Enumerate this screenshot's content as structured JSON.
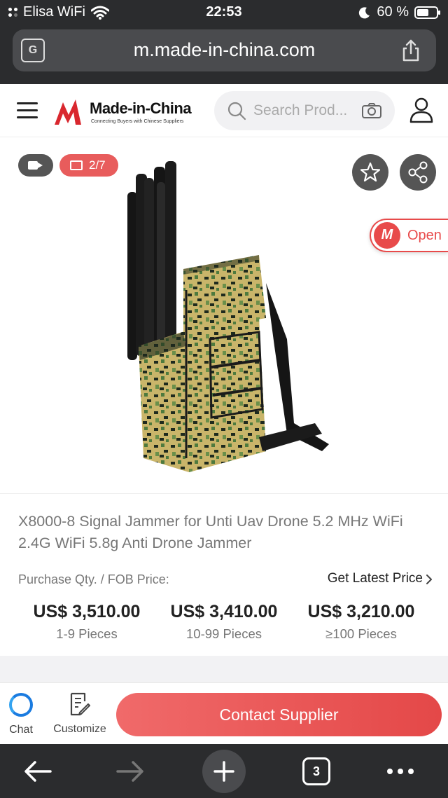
{
  "status_bar": {
    "carrier": "Elisa WiFi",
    "time": "22:53",
    "battery": "60 %",
    "battery_level": 0.6
  },
  "browser": {
    "url": "m.made-in-china.com",
    "tab_count": "3"
  },
  "header": {
    "brand": "Made-in-China",
    "tagline": "Connecting Buyers with Chinese Suppliers",
    "search_placeholder": "Search Prod..."
  },
  "gallery": {
    "image_counter": "2/7",
    "open_label": "Open",
    "open_logo_text": "M"
  },
  "product": {
    "title": "X8000-8 Signal Jammer for Unti Uav Drone 5.2 MHz WiFi 2.4G WiFi 5.8g Anti Drone Jammer",
    "qty_label": "Purchase Qty. / FOB Price:",
    "latest_price_link": "Get Latest Price",
    "tiers": [
      {
        "price": "US$ 3,510.00",
        "range": "1-9 Pieces"
      },
      {
        "price": "US$ 3,410.00",
        "range": "10-99 Pieces"
      },
      {
        "price": "US$ 3,210.00",
        "range": "≥100 Pieces"
      }
    ]
  },
  "actions": {
    "chat": "Chat",
    "customize": "Customize",
    "contact": "Contact Supplier"
  },
  "colors": {
    "brand_red": "#e84a4a",
    "chrome_dark": "#2b2c2e",
    "chat_blue": "#1a7be0"
  }
}
